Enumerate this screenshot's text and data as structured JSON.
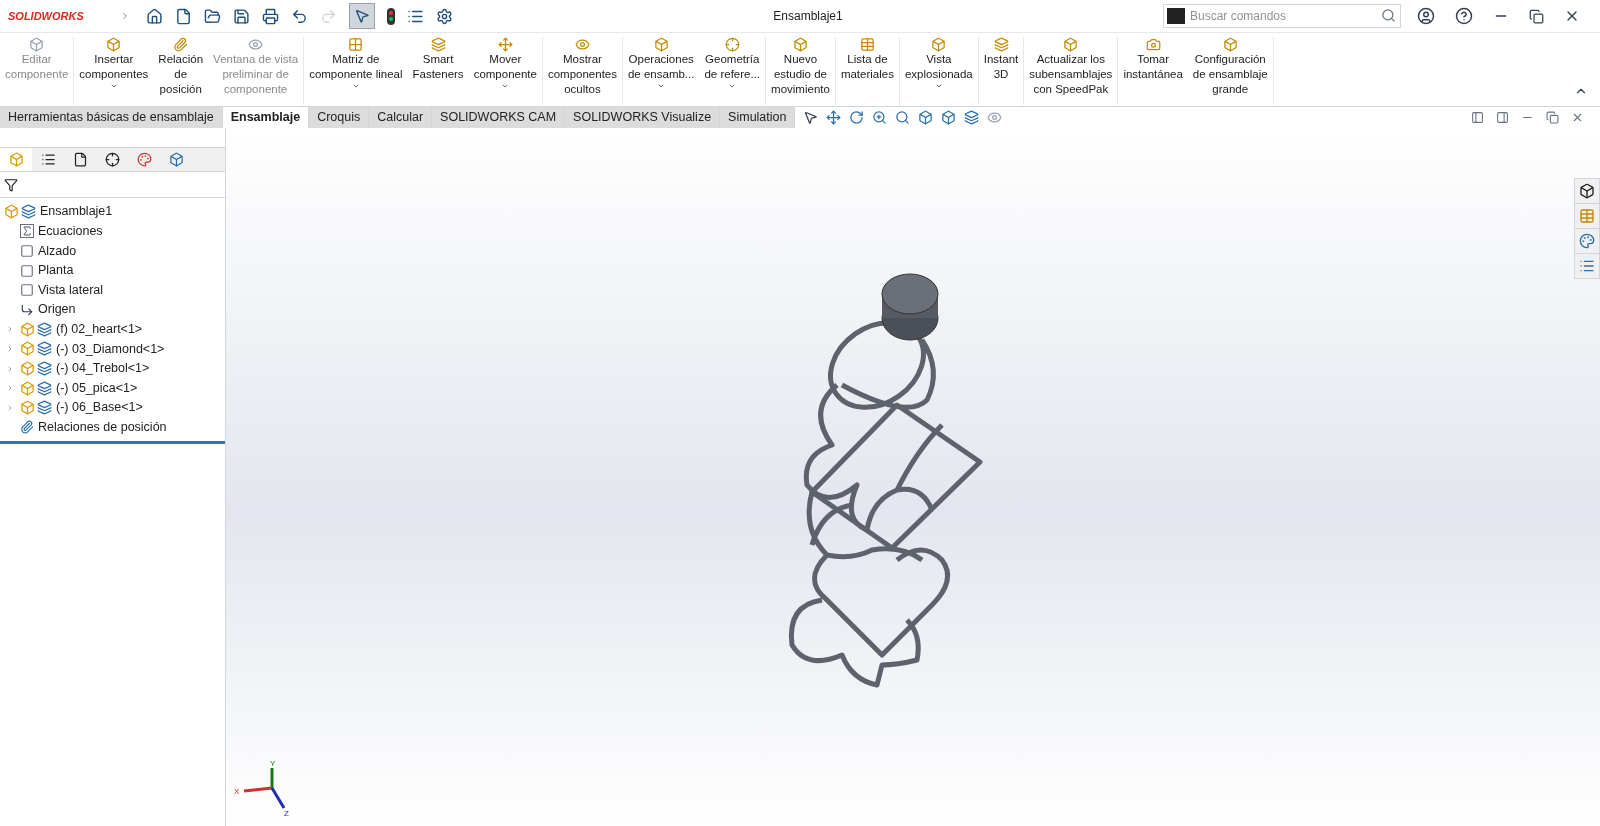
{
  "app": {
    "logo": "SOLIDWORKS",
    "title": "Ensamblaje1",
    "search": {
      "placeholder": "Buscar comandos"
    }
  },
  "ribbon": [
    [
      {
        "label": "Editar\ncomponente",
        "disabled": true,
        "dropdown": false
      }
    ],
    [
      {
        "label": "Insertar\ncomponentes",
        "disabled": false,
        "dropdown": true
      },
      {
        "label": "Relación\nde\nposición",
        "disabled": false,
        "dropdown": false
      },
      {
        "label": "Ventana de vista\npreliminar de\ncomponente",
        "disabled": true,
        "dropdown": false
      }
    ],
    [
      {
        "label": "Matriz de\ncomponente lineal",
        "disabled": false,
        "dropdown": true
      },
      {
        "label": "Smart\nFasteners",
        "disabled": false,
        "dropdown": false
      },
      {
        "label": "Mover\ncomponente",
        "disabled": false,
        "dropdown": true
      }
    ],
    [
      {
        "label": "Mostrar\ncomponentes\nocultos",
        "disabled": false,
        "dropdown": false
      }
    ],
    [
      {
        "label": "Operaciones\nde ensamb...",
        "disabled": false,
        "dropdown": true
      },
      {
        "label": "Geometría\nde refere...",
        "disabled": false,
        "dropdown": true
      }
    ],
    [
      {
        "label": "Nuevo\nestudio de\nmovimiento",
        "disabled": false,
        "dropdown": false
      }
    ],
    [
      {
        "label": "Lista de\nmateriales",
        "disabled": false,
        "dropdown": false
      }
    ],
    [
      {
        "label": "Vista\nexplosionada",
        "disabled": false,
        "dropdown": true
      }
    ],
    [
      {
        "label": "Instant\n3D",
        "disabled": false,
        "dropdown": false
      }
    ],
    [
      {
        "label": "Actualizar los\nsubensamblajes\ncon SpeedPak",
        "disabled": false,
        "dropdown": false
      }
    ],
    [
      {
        "label": "Tomar\ninstantánea",
        "disabled": false,
        "dropdown": false
      },
      {
        "label": "Configuración\nde ensamblaje\ngrande",
        "disabled": false,
        "dropdown": false
      }
    ]
  ],
  "tabs": [
    {
      "label": "Herramientas básicas de ensamblaje",
      "selected": false
    },
    {
      "label": "Ensamblaje",
      "selected": true
    },
    {
      "label": "Croquis",
      "selected": false
    },
    {
      "label": "Calcular",
      "selected": false
    },
    {
      "label": "SOLIDWORKS CAM",
      "selected": false
    },
    {
      "label": "SOLIDWORKS Visualize",
      "selected": false
    },
    {
      "label": "Simulation",
      "selected": false
    }
  ],
  "tree": [
    {
      "kind": "assembly",
      "label": "Ensamblaje1",
      "expandable": false
    },
    {
      "kind": "equations",
      "label": "Ecuaciones",
      "expandable": false
    },
    {
      "kind": "plane",
      "label": "Alzado",
      "expandable": false
    },
    {
      "kind": "plane",
      "label": "Planta",
      "expandable": false
    },
    {
      "kind": "plane",
      "label": "Vista lateral",
      "expandable": false
    },
    {
      "kind": "origin",
      "label": "Origen",
      "expandable": false
    },
    {
      "kind": "part",
      "label": "(f) 02_heart<1>",
      "expandable": true
    },
    {
      "kind": "part",
      "label": "(-) 03_Diamond<1>",
      "expandable": true
    },
    {
      "kind": "part",
      "label": "(-) 04_Trebol<1>",
      "expandable": true
    },
    {
      "kind": "part",
      "label": "(-) 05_pica<1>",
      "expandable": true
    },
    {
      "kind": "part",
      "label": "(-) 06_Base<1>",
      "expandable": true
    },
    {
      "kind": "mates",
      "label": "Relaciones de posición",
      "expandable": false
    }
  ],
  "triad": {
    "x": "X",
    "y": "Y",
    "z": "Z"
  }
}
